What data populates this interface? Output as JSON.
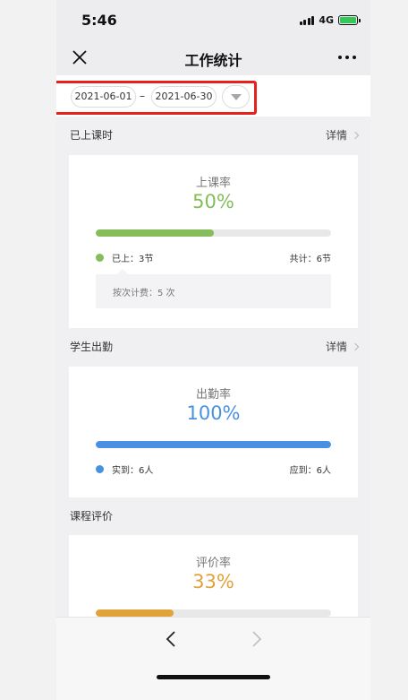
{
  "status_bar": {
    "time": "5:46",
    "network": "4G"
  },
  "nav": {
    "title": "工作统计",
    "close_icon": "close-icon",
    "more_icon": "more-icon"
  },
  "filter": {
    "start_date": "2021-06-01",
    "separator": "–",
    "end_date": "2021-06-30",
    "dropdown_icon": "triangle-down-icon"
  },
  "sections": [
    {
      "title": "已上课时",
      "detail": "详情",
      "card": {
        "label": "上课率",
        "value": "50%",
        "progress": 0.5,
        "color": "#84bd59",
        "left_stat": "已上：3节",
        "right_stat": "共计：6节",
        "note": "按次计费：5 次"
      }
    },
    {
      "title": "学生出勤",
      "detail": "详情",
      "card": {
        "label": "出勤率",
        "value": "100%",
        "progress": 1.0,
        "color": "#4a90e2",
        "left_stat": "实到：6人",
        "right_stat": "应到：6人"
      }
    },
    {
      "title": "课程评价",
      "card": {
        "label": "评价率",
        "value": "33%",
        "progress": 0.33,
        "color": "#e0a33a"
      }
    }
  ],
  "bottom": {
    "back_icon": "chevron-left-icon",
    "forward_icon": "chevron-right-icon"
  },
  "colors": {
    "highlight": "#e8201c",
    "background": "#f0f0f3"
  }
}
